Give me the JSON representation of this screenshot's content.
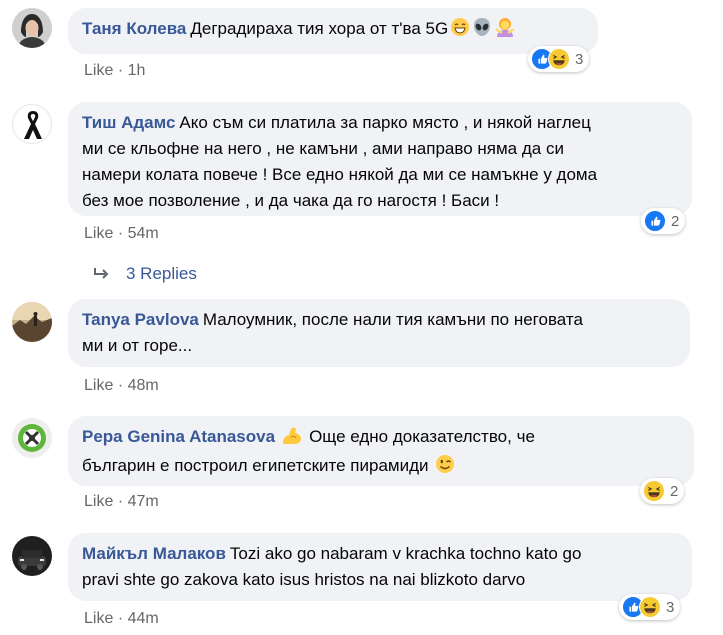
{
  "comments": [
    {
      "author": "Таня Колева",
      "text": "Деградираха тия хора от т'ва 5G",
      "emojis": [
        "grin-emoji",
        "alien-emoji",
        "woman-gesturing-emoji"
      ],
      "meta": {
        "like": "Like",
        "sep": "·",
        "time": "1h"
      },
      "reactions": {
        "types": [
          "like",
          "haha"
        ],
        "count": "3"
      }
    },
    {
      "author": "Тиш Адамс",
      "text_lines": [
        "Ако съм си платила за парко място , и някой наглец",
        "ми се кльофне на него , не камъни , ами направо няма да си",
        "намери колата повече ! Все едно някой да ми се намъкне у дома",
        "без мое позволение , и да чака да го нагостя ! Баси !"
      ],
      "meta": {
        "like": "Like",
        "sep": "·",
        "time": "54m"
      },
      "reactions": {
        "types": [
          "like"
        ],
        "count": "2"
      }
    },
    {
      "author": "Tanya Pavlova",
      "text_lines": [
        "Малоумник, после нали тия камъни по неговата",
        "ми и от горе..."
      ],
      "meta": {
        "like": "Like",
        "sep": "·",
        "time": "48m"
      }
    },
    {
      "author": "Pepa Genina Atanasova",
      "text_lines": [
        "Още едно доказателство, че",
        "българин е построил египетските пирамиди"
      ],
      "emojis": [
        "flexed-biceps-emoji",
        "wink-emoji"
      ],
      "meta": {
        "like": "Like",
        "sep": "·",
        "time": "47m"
      },
      "reactions": {
        "types": [
          "haha"
        ],
        "count": "2"
      }
    },
    {
      "author": "Майкъл Малаков",
      "text_lines": [
        "Tozi ako go nabaram v krachka tochno kato go",
        "pravi shte go zakova kato isus hristos na nai blizkoto darvo"
      ],
      "meta": {
        "like": "Like",
        "sep": "·",
        "time": "44m"
      },
      "reactions": {
        "types": [
          "like",
          "haha"
        ],
        "count": "3"
      }
    }
  ],
  "replies": {
    "label": "3 Replies",
    "icon": "reply-arrow-icon"
  },
  "colors": {
    "author": "#385898",
    "bubble": "#f0f2f5",
    "meta": "#65676b",
    "like_blue": "#1877f2",
    "haha_yellow": "#f7c932"
  }
}
